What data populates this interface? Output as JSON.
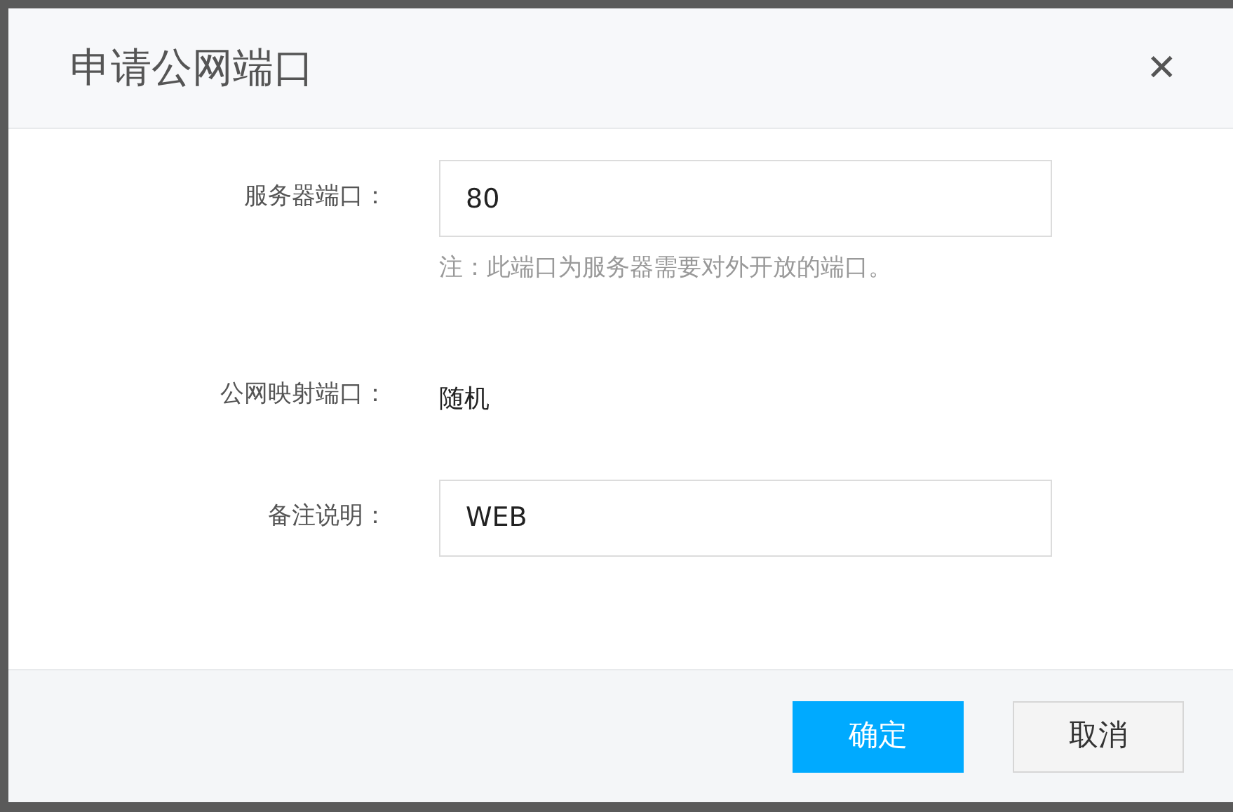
{
  "dialog": {
    "title": "申请公网端口",
    "close": "✕"
  },
  "fields": [
    {
      "kind": "input",
      "label": "服务器端口：",
      "value": "80",
      "hint": "注：此端口为服务器需要对外开放的端口。"
    },
    {
      "kind": "text",
      "label": "公网映射端口：",
      "value": "随机"
    },
    {
      "kind": "input",
      "label": "备注说明：",
      "value": "WEB"
    }
  ],
  "buttons": [
    {
      "kind": "primary",
      "label": "确定"
    },
    {
      "kind": "secondary",
      "label": "取消"
    }
  ]
}
